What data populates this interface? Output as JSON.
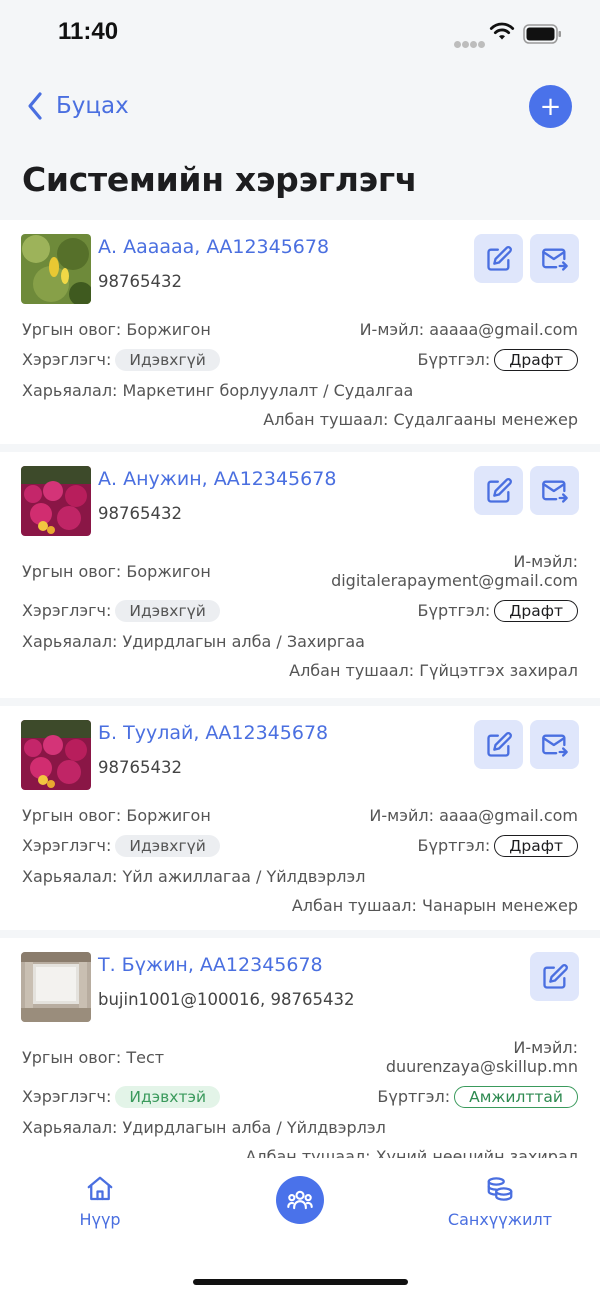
{
  "status": {
    "time": "11:40"
  },
  "nav": {
    "back_label": "Буцах",
    "add_label": "+"
  },
  "page": {
    "title": "Системийн хэрэглэгч"
  },
  "labels": {
    "clan": "Ургын овог:",
    "email": "И-мэйл:",
    "user": "Хэрэглэгч:",
    "registration": "Бүртгэл:",
    "affiliation": "Харьяалал:",
    "position": "Албан тушаал:"
  },
  "users": [
    {
      "name": "А. Аааааа, АА12345678",
      "sub": "98765432",
      "clan": "Боржигон",
      "email": "aaaaa@gmail.com",
      "user_status": "Идэвхгүй",
      "registration": "Драфт",
      "affiliation": "Маркетинг борлуулалт / Судалгаа",
      "position": "Судалгааны менежер"
    },
    {
      "name": "А. Анужин, АА12345678",
      "sub": "98765432",
      "clan": "Боржигон",
      "email": "digitalerapayment@gmail.com",
      "user_status": "Идэвхгүй",
      "registration": "Драфт",
      "affiliation": "Удирдлагын алба / Захиргаа",
      "position": "Гүйцэтгэх захирал"
    },
    {
      "name": "Б. Туулай, АА12345678",
      "sub": "98765432",
      "clan": "Боржигон",
      "email": "aaaa@gmail.com",
      "user_status": "Идэвхгүй",
      "registration": "Драфт",
      "affiliation": "Үйл ажиллагаа / Үйлдвэрлэл",
      "position": "Чанарын менежер"
    },
    {
      "name": "Т. Бүжин, АА12345678",
      "sub": "bujin1001@100016, 98765432",
      "clan": "Тест",
      "email": "duurenzaya@skillup.mn",
      "user_status": "Идэвхтэй",
      "registration": "Амжилттай",
      "affiliation": "Удирдлагын алба / Үйлдвэрлэл",
      "position": "Хүний нөөцийн захирал"
    }
  ],
  "tabs": {
    "home": "Нүүр",
    "finance": "Санхүүжилт"
  },
  "colors": {
    "accent": "#4a6fe0",
    "accent_fill": "#4a72ea",
    "success": "#3a9a5c"
  },
  "icons": {
    "back": "chevron-left-icon",
    "add": "plus-icon",
    "edit": "edit-icon",
    "mail": "mail-forward-icon",
    "home": "home-icon",
    "users": "users-icon",
    "finance": "coins-icon"
  }
}
